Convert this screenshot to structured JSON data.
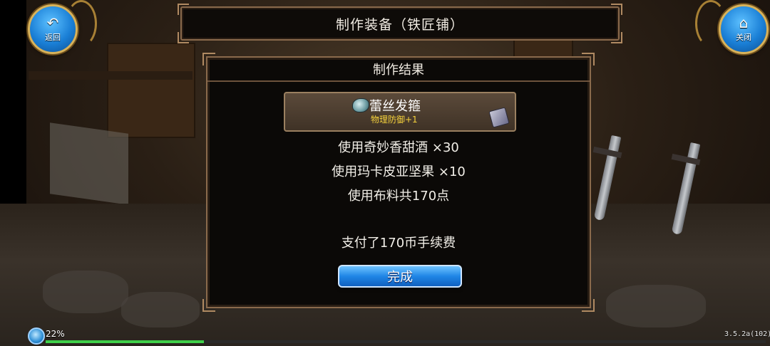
{
  "header": {
    "title": "制作装备（铁匠铺）",
    "back_label": "返回",
    "close_label": "关闭"
  },
  "result_panel": {
    "title": "制作结果",
    "item": {
      "name": "蕾丝发箍",
      "stat": "物理防御+1"
    },
    "materials": [
      "使用奇妙香甜酒 ×30",
      "使用玛卡皮亚坚果 ×10",
      "使用布料共170点"
    ],
    "fee_text": "支付了170币手续费",
    "done_label": "完成"
  },
  "status": {
    "percent": "22%",
    "progress_fraction": 0.22,
    "version": "3.5.2a(102)"
  },
  "icons": {
    "back": "back-arrow-icon",
    "close": "home-icon",
    "item": "hairband-icon",
    "badge": "equipment-badge-icon",
    "status": "network-icon"
  },
  "colors": {
    "accent_blue": "#1f86e6",
    "stat_yellow": "#f6d23c",
    "frame_brown": "#8a6a4c",
    "progress_green": "#3fd04a"
  }
}
